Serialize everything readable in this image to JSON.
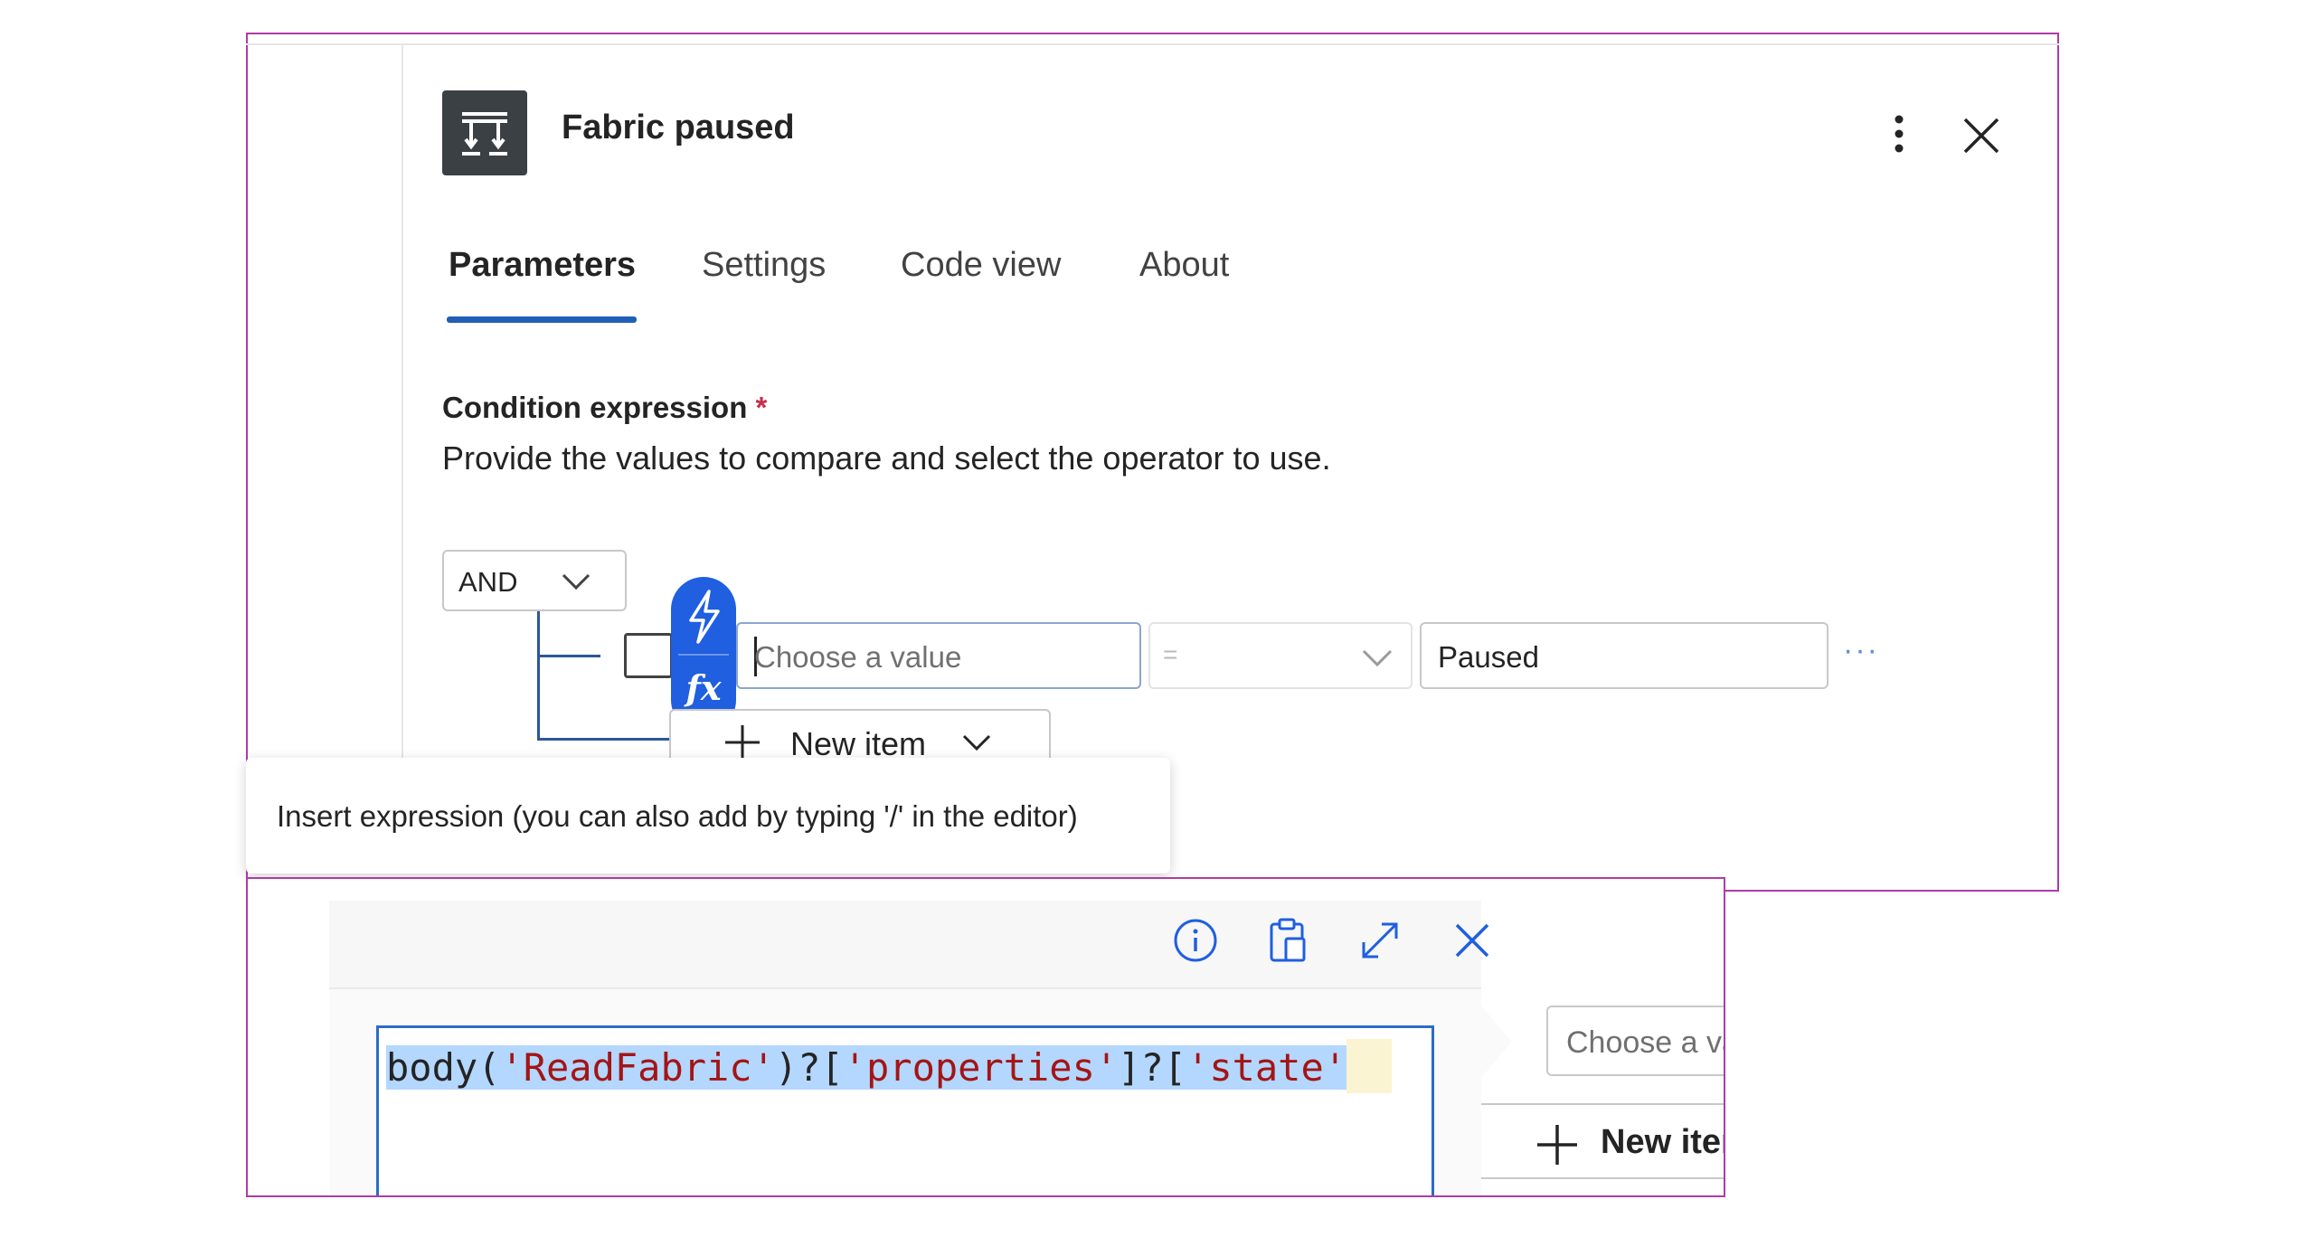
{
  "action": {
    "title": "Fabric paused",
    "icon": "condition-icon"
  },
  "header_buttons": {
    "more": "more-vertical-icon",
    "close": "close-icon"
  },
  "tabs": [
    {
      "label": "Parameters",
      "active": true
    },
    {
      "label": "Settings",
      "active": false
    },
    {
      "label": "Code view",
      "active": false
    },
    {
      "label": "About",
      "active": false
    }
  ],
  "condition": {
    "label": "Condition expression",
    "required_marker": "*",
    "description": "Provide the values to compare and select the operator to use.",
    "group_operator": "AND",
    "row": {
      "left_placeholder": "Choose a value",
      "operator": "=",
      "right_value": "Paused",
      "more": "···"
    },
    "new_item_label": "New item"
  },
  "tooltip": {
    "text": "Insert expression (you can also add by typing '/' in the editor)"
  },
  "expression_editor": {
    "toolbar_icons": [
      "info-icon",
      "paste-icon",
      "expand-icon",
      "close-icon"
    ],
    "tokens": [
      {
        "text": "body(",
        "kind": "fn"
      },
      {
        "text": "'ReadFabric'",
        "kind": "str"
      },
      {
        "text": ")?[",
        "kind": "fn"
      },
      {
        "text": "'properties'",
        "kind": "str"
      },
      {
        "text": "]?[",
        "kind": "fn"
      },
      {
        "text": "'state'",
        "kind": "str"
      }
    ],
    "selected": true
  },
  "background_form": {
    "choose_placeholder": "Choose a value",
    "new_item_label": "New item"
  },
  "colors": {
    "accent": "#1f5fb8",
    "fx_button": "#1f5fe0",
    "frame": "#b03aa8",
    "string_token": "#a31515",
    "selection": "#b4d7ff"
  }
}
